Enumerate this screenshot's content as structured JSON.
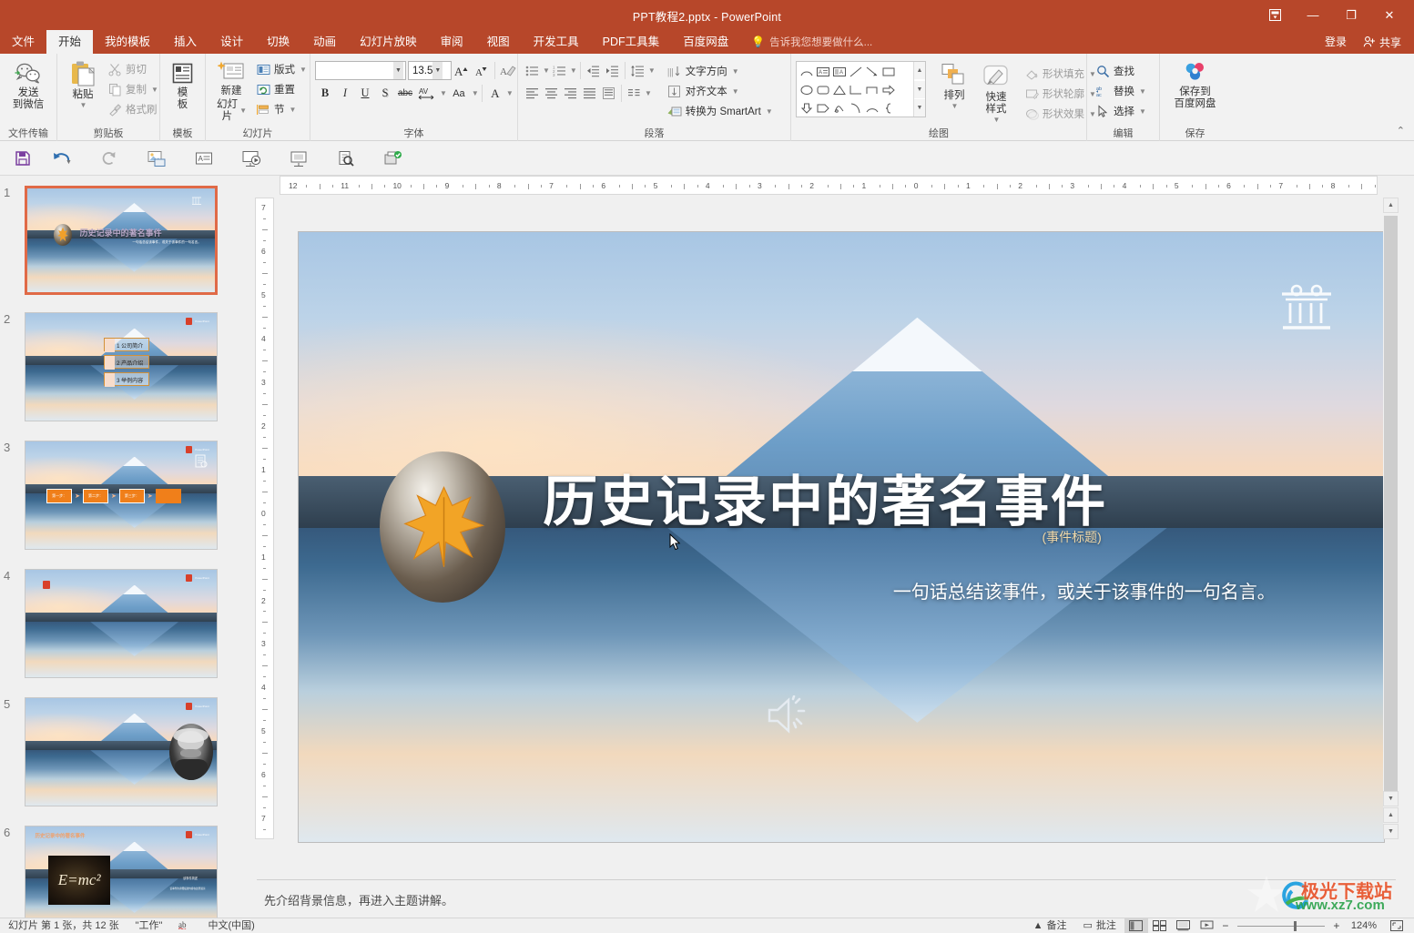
{
  "window": {
    "title": "PPT教程2.pptx - PowerPoint",
    "ribbon_display_icon": "ribbon-display-options-icon",
    "minimize": "—",
    "restore": "❐",
    "close": "✕"
  },
  "tabs": [
    {
      "label": "文件",
      "active": false,
      "file": true
    },
    {
      "label": "开始",
      "active": true
    },
    {
      "label": "我的模板",
      "active": false
    },
    {
      "label": "插入",
      "active": false
    },
    {
      "label": "设计",
      "active": false
    },
    {
      "label": "切换",
      "active": false
    },
    {
      "label": "动画",
      "active": false
    },
    {
      "label": "幻灯片放映",
      "active": false
    },
    {
      "label": "审阅",
      "active": false
    },
    {
      "label": "视图",
      "active": false
    },
    {
      "label": "开发工具",
      "active": false
    },
    {
      "label": "PDF工具集",
      "active": false
    },
    {
      "label": "百度网盘",
      "active": false
    }
  ],
  "tellme": {
    "placeholder": "告诉我您想要做什么...",
    "icon": "lightbulb-icon"
  },
  "account": {
    "signin": "登录",
    "share": "共享",
    "share_icon": "person-share-icon"
  },
  "ribbon": {
    "groups": [
      {
        "title": "文件传输",
        "big": [
          {
            "label": "发送\n到微信",
            "label1": "发送",
            "label2": "到微信",
            "icon": "wechat-icon"
          }
        ]
      },
      {
        "title": "剪贴板",
        "big": [
          {
            "label1": "粘贴",
            "label2": "",
            "icon": "paste-icon"
          }
        ],
        "small": [
          {
            "label": "剪切",
            "icon": "scissors-icon",
            "enabled": false
          },
          {
            "label": "复制",
            "icon": "copy-icon",
            "enabled": false,
            "caret": true
          },
          {
            "label": "格式刷",
            "icon": "format-painter-icon",
            "enabled": false
          }
        ]
      },
      {
        "title": "模板",
        "big": [
          {
            "label1": "模",
            "label2": "板",
            "icon": "template-icon"
          }
        ]
      },
      {
        "title": "幻灯片",
        "big": [
          {
            "label1": "新建",
            "label2": "幻灯片",
            "icon": "new-slide-icon",
            "caret": true
          }
        ],
        "small": [
          {
            "label": "版式",
            "icon": "layout-icon",
            "enabled": true,
            "caret": true
          },
          {
            "label": "重置",
            "icon": "reset-icon",
            "enabled": true
          },
          {
            "label": "节",
            "icon": "section-icon",
            "enabled": true,
            "caret": true
          }
        ]
      },
      {
        "title": "字体",
        "font_name": "",
        "font_size": "13.5",
        "buttons": [
          "B",
          "I",
          "U",
          "S",
          "abc",
          "AV",
          "Aa",
          "A"
        ],
        "grow_icon": "grow-font-icon",
        "shrink_icon": "shrink-font-icon",
        "clear_icon": "clear-formatting-icon"
      },
      {
        "title": "段落",
        "small": [
          {
            "label": "文字方向",
            "icon": "text-direction-icon",
            "enabled": true,
            "caret": true
          },
          {
            "label": "对齐文本",
            "icon": "align-text-icon",
            "enabled": true,
            "caret": true
          },
          {
            "label": "转换为 SmartArt",
            "icon": "smartart-icon",
            "enabled": true,
            "caret": true
          }
        ]
      },
      {
        "title": "绘图",
        "big": [
          {
            "label1": "排列",
            "label2": "",
            "icon": "arrange-icon",
            "caret": true
          },
          {
            "label1": "快速样式",
            "label2": "",
            "icon": "quick-styles-icon",
            "caret": true
          }
        ],
        "small": [
          {
            "label": "形状填充",
            "icon": "shape-fill-icon",
            "enabled": false,
            "caret": true
          },
          {
            "label": "形状轮廓",
            "icon": "shape-outline-icon",
            "enabled": false,
            "caret": true
          },
          {
            "label": "形状效果",
            "icon": "shape-effects-icon",
            "enabled": false,
            "caret": true
          }
        ]
      },
      {
        "title": "编辑",
        "small": [
          {
            "label": "查找",
            "icon": "search-icon",
            "enabled": true
          },
          {
            "label": "替换",
            "icon": "replace-icon",
            "enabled": true,
            "caret": true
          },
          {
            "label": "选择",
            "icon": "select-icon",
            "enabled": true,
            "caret": true
          }
        ]
      },
      {
        "title": "保存",
        "big": [
          {
            "label1": "保存到",
            "label2": "百度网盘",
            "icon": "baidu-netdisk-icon"
          }
        ]
      }
    ],
    "collapse_icon": "chevron-up-icon"
  },
  "qat": [
    {
      "name": "save-icon"
    },
    {
      "name": "undo-icon",
      "caret": true
    },
    {
      "name": "redo-icon"
    },
    {
      "name": "insert-picture-icon"
    },
    {
      "name": "text-box-icon"
    },
    {
      "name": "start-slideshow-icon"
    },
    {
      "name": "presenter-view-icon"
    },
    {
      "name": "print-preview-icon"
    },
    {
      "name": "document-check-icon"
    }
  ],
  "slides": [
    {
      "num": "1",
      "selected": true,
      "type": "title",
      "title": "历史记录中的著名事件",
      "subtitle": "一句话总结该事件，或关于该事件的一句名言。"
    },
    {
      "num": "2",
      "selected": false,
      "type": "menu",
      "items": [
        "1 公司简介",
        "2 产品介绍",
        "3 举例内容"
      ]
    },
    {
      "num": "3",
      "selected": false,
      "type": "steps",
      "items": [
        "第一步：",
        "第二步：",
        "第三步："
      ]
    },
    {
      "num": "4",
      "selected": false,
      "type": "plain"
    },
    {
      "num": "5",
      "selected": false,
      "type": "portrait"
    },
    {
      "num": "6",
      "selected": false,
      "type": "formula",
      "formula": "Ε=mc²"
    }
  ],
  "slide": {
    "title": "历史记录中的著名事件",
    "title_note": "(事件标题)",
    "subtitle": "一句话总结该事件，或关于该事件的一句名言。",
    "leaf_icon": "autumn-leaf-image",
    "pillar_icon": "greek-pillar-icon",
    "speaker_icon": "audio-speaker-icon"
  },
  "rulers": {
    "horizontal": [
      "12",
      "11",
      "10",
      "9",
      "8",
      "7",
      "6",
      "5",
      "4",
      "3",
      "2",
      "1",
      "0",
      "1",
      "2",
      "3",
      "4",
      "5",
      "6",
      "7",
      "8",
      "9",
      "10",
      "11",
      "12"
    ],
    "vertical": [
      "7",
      "6",
      "5",
      "4",
      "3",
      "2",
      "1",
      "0",
      "1",
      "2",
      "3",
      "4",
      "5",
      "6",
      "7"
    ]
  },
  "notes": {
    "text": "先介绍背景信息，再进入主题讲解。"
  },
  "status": {
    "slide_info": "幻灯片 第 1 张，共 12 张",
    "theme": "\"工作\"",
    "language_icon": "proofing-icon",
    "language": "中文(中国)",
    "notes_label": "备注",
    "comments_label": "批注",
    "notes_icon": "notes-icon",
    "comments_icon": "comments-icon",
    "views": [
      "normal-view-icon",
      "slide-sorter-icon",
      "reading-view-icon",
      "slideshow-icon"
    ],
    "active_view": 0,
    "zoom": "124%",
    "zoom_minus": "−",
    "zoom_plus": "+",
    "fit_icon": "fit-to-window-icon"
  },
  "watermark": {
    "brand": "极光下载站",
    "url": "www.xz7.com"
  },
  "colors": {
    "accent": "#b7472a",
    "ribbon_bg": "#f2f2f2",
    "selection": "#e06a47"
  }
}
